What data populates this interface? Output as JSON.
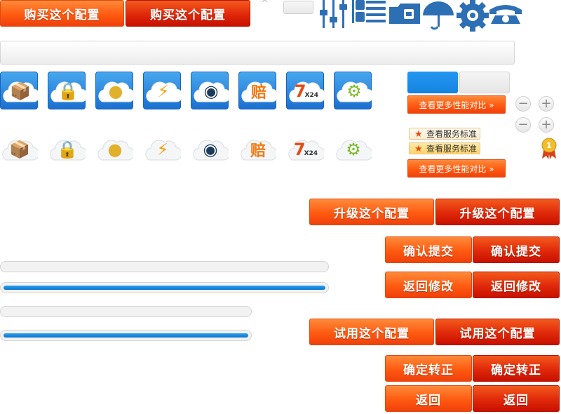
{
  "buy": {
    "label_1": "购买这个配置",
    "label_2": "购买这个配置"
  },
  "caret": "^",
  "icons": [
    "sliders-icon",
    "layout-icon",
    "list-icon",
    "folder-icon",
    "umbrella-icon",
    "gear-icon",
    "telephone-icon"
  ],
  "tiles": [
    {
      "name": "package-icon",
      "glyph": "📦",
      "color": "#e0892a"
    },
    {
      "name": "lock-icon",
      "glyph": "🔒",
      "color": "#d9a22e"
    },
    {
      "name": "coins-icon",
      "glyph": "●",
      "color": "#e2b12c"
    },
    {
      "name": "lightning-icon",
      "glyph": "⚡",
      "color": "#f3a10d"
    },
    {
      "name": "radar-icon",
      "glyph": "◉",
      "color": "#1c3a5a"
    },
    {
      "name": "compensation-icon",
      "glyph": "赔",
      "color": "#f07b14"
    },
    {
      "name": "service-7x24-icon",
      "glyph": "7",
      "sub": "X24",
      "color": "#e84a14"
    },
    {
      "name": "settings-gear-icon",
      "glyph": "⚙",
      "color": "#7cbb27"
    }
  ],
  "compare": {
    "label_1": "查看更多性能对比 »",
    "label_2": "查看更多性能对比 »"
  },
  "service": {
    "label_1": "查看服务标准",
    "label_2": "查看服务标准"
  },
  "rank_badge": "1",
  "progress": [
    0.0,
    1.0,
    0.0,
    1.0
  ],
  "upgrade": {
    "label_1": "升级这个配置",
    "label_2": "升级这个配置"
  },
  "confirm_submit": {
    "label_1": "确认提交",
    "label_2": "确认提交"
  },
  "back_edit": {
    "label_1": "返回修改",
    "label_2": "返回修改"
  },
  "trial": {
    "label_1": "试用这个配置",
    "label_2": "试用这个配置"
  },
  "confirm_switch": {
    "label_1": "确定转正",
    "label_2": "确定转正"
  },
  "back": {
    "label_1": "返回",
    "label_2": "返回"
  },
  "colors": {
    "accent_orange": "#ff5a10",
    "accent_red": "#e0280a",
    "blue": "#1b6fcf",
    "progress_blue": "#1487d9"
  }
}
